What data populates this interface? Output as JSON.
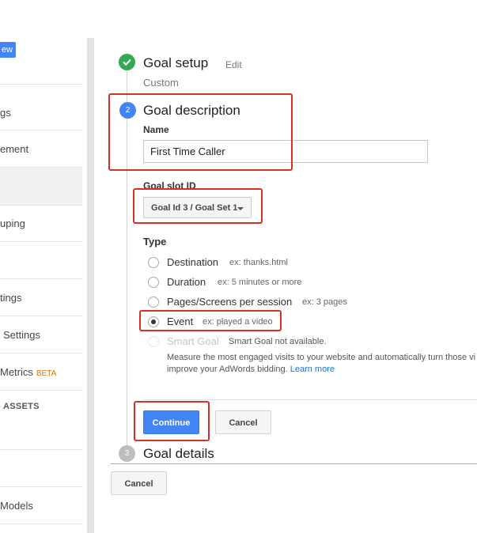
{
  "sidebar": {
    "new_button": "ew",
    "items": [
      {
        "label": "gs"
      },
      {
        "label": "ement"
      },
      {
        "label": "uping"
      },
      {
        "label": "tings"
      },
      {
        "label": "Settings"
      },
      {
        "label": "Metrics",
        "badge": "BETA"
      },
      {
        "label": "Models"
      }
    ],
    "section_heading": "ASSETS"
  },
  "steps": {
    "step1": {
      "title": "Goal setup",
      "edit": "Edit",
      "subtitle": "Custom"
    },
    "step2": {
      "number": "2",
      "title": "Goal description"
    },
    "step3": {
      "number": "3",
      "title": "Goal details"
    }
  },
  "form": {
    "name_label": "Name",
    "name_value": "First Time Caller",
    "slot_label": "Goal slot ID",
    "slot_value": "Goal Id 3 / Goal Set 1",
    "type_label": "Type",
    "types": [
      {
        "label": "Destination",
        "example": "ex: thanks.html",
        "checked": false,
        "disabled": false
      },
      {
        "label": "Duration",
        "example": "ex: 5 minutes or more",
        "checked": false,
        "disabled": false
      },
      {
        "label": "Pages/Screens per session",
        "example": "ex: 3 pages",
        "checked": false,
        "disabled": false
      },
      {
        "label": "Event",
        "example": "ex: played a video",
        "checked": true,
        "disabled": false
      },
      {
        "label": "Smart Goal",
        "example": "Smart Goal not available.",
        "checked": false,
        "disabled": true
      }
    ],
    "smart_desc": "Measure the most engaged visits to your website and automatically turn those vi",
    "smart_desc2": "improve your AdWords bidding.",
    "learn_more": "Learn more"
  },
  "buttons": {
    "continue": "Continue",
    "cancel": "Cancel",
    "cancel_bottom": "Cancel"
  },
  "colors": {
    "accent": "#4285f4",
    "success": "#34a853",
    "highlight": "#d93025"
  }
}
